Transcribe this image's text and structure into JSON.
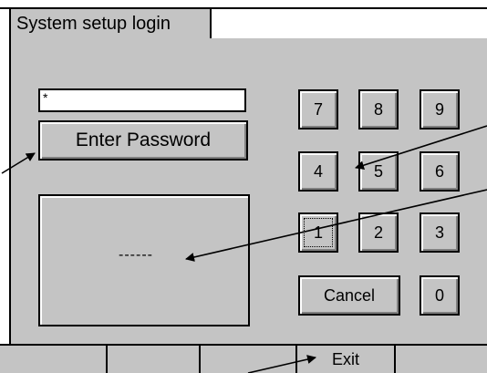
{
  "tab": {
    "label": "System setup login"
  },
  "password": {
    "value": "*"
  },
  "enter_button": {
    "label": "Enter Password"
  },
  "display": {
    "text": "------"
  },
  "keypad": {
    "keys": [
      "7",
      "8",
      "9",
      "4",
      "5",
      "6",
      "1",
      "2",
      "3"
    ],
    "cancel": "Cancel",
    "zero": "0"
  },
  "bottom": {
    "exit": "Exit"
  }
}
